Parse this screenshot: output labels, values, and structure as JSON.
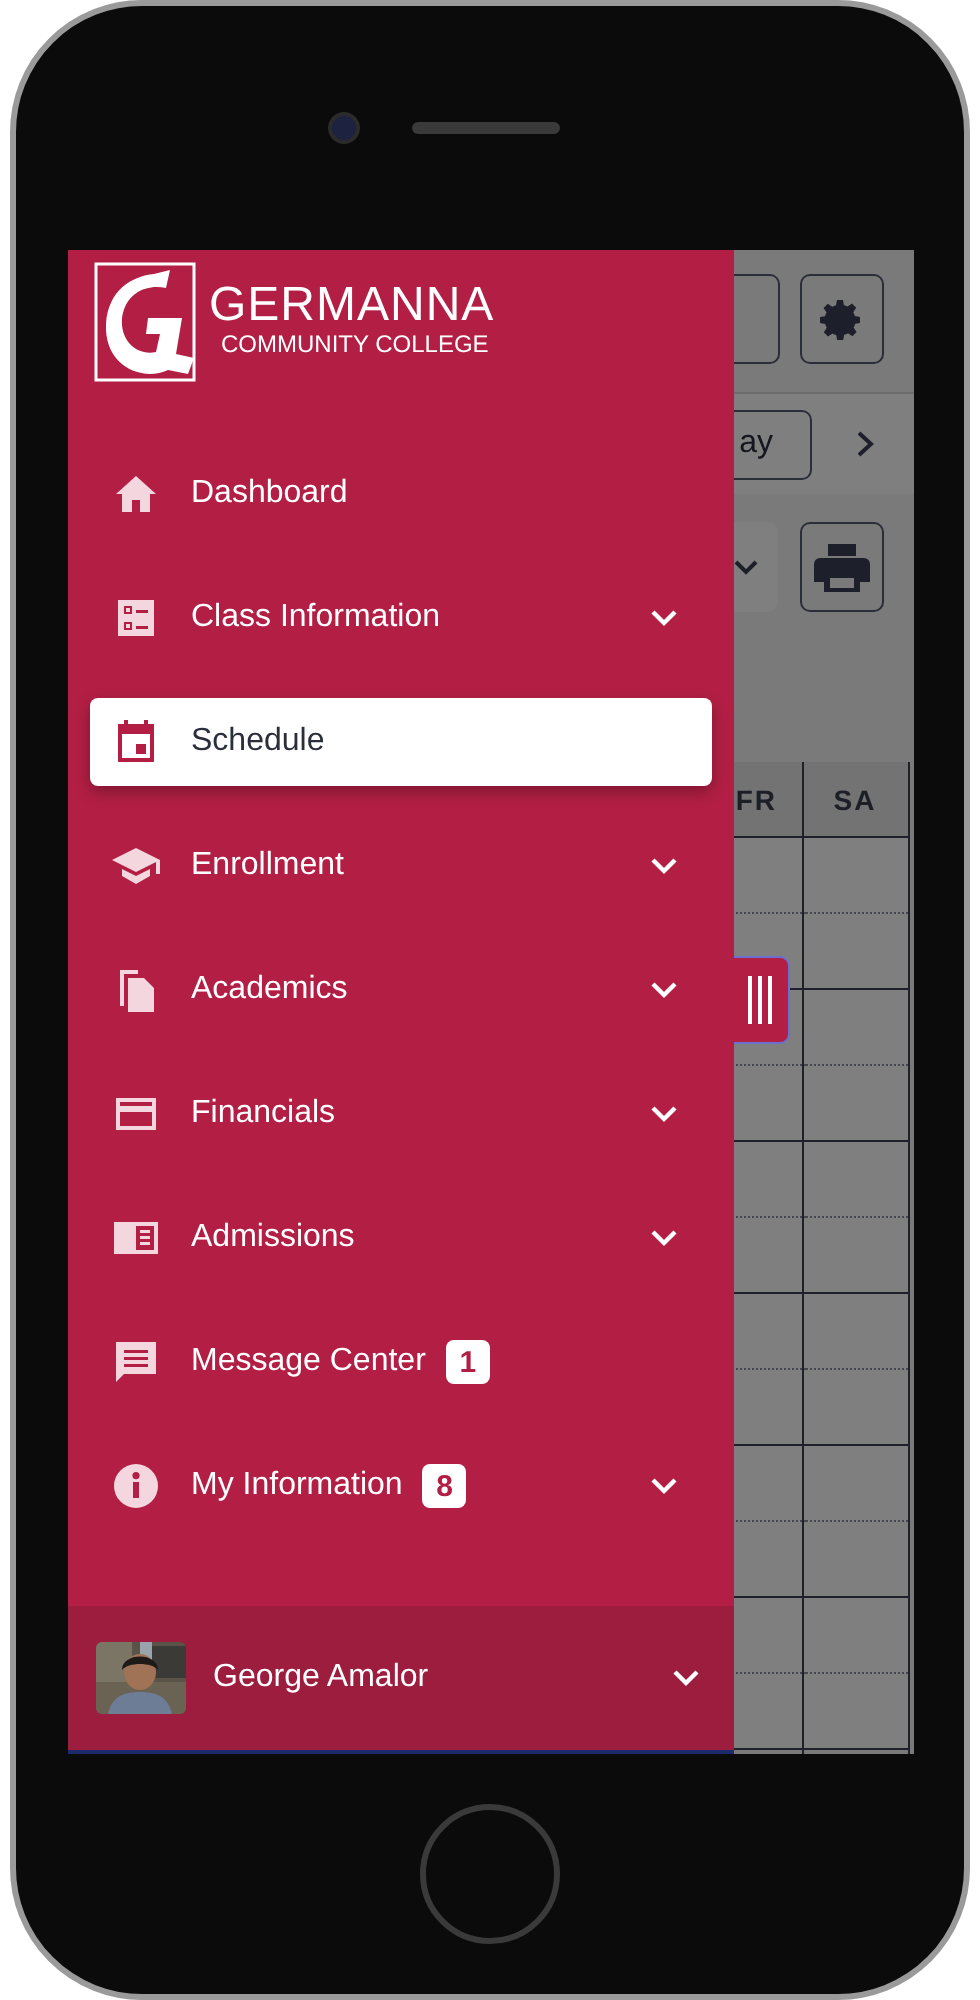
{
  "schedule_page": {
    "today_button": "ay",
    "day_columns": [
      "FR",
      "SA"
    ]
  },
  "drawer": {
    "logo": {
      "name": "GERMANNA",
      "subtitle": "COMMUNITY COLLEGE"
    },
    "items": [
      {
        "label": "Dashboard",
        "has_submenu": false,
        "selected": false
      },
      {
        "label": "Class Information",
        "has_submenu": true,
        "selected": false
      },
      {
        "label": "Schedule",
        "has_submenu": false,
        "selected": true
      },
      {
        "label": "Enrollment",
        "has_submenu": true,
        "selected": false
      },
      {
        "label": "Academics",
        "has_submenu": true,
        "selected": false
      },
      {
        "label": "Financials",
        "has_submenu": true,
        "selected": false
      },
      {
        "label": "Admissions",
        "has_submenu": true,
        "selected": false
      },
      {
        "label": "Message Center",
        "badge": "1",
        "has_submenu": false,
        "selected": false
      },
      {
        "label": "My Information",
        "badge": "8",
        "has_submenu": true,
        "selected": false
      }
    ],
    "user": {
      "name": "George Amalor",
      "has_submenu": true
    }
  }
}
